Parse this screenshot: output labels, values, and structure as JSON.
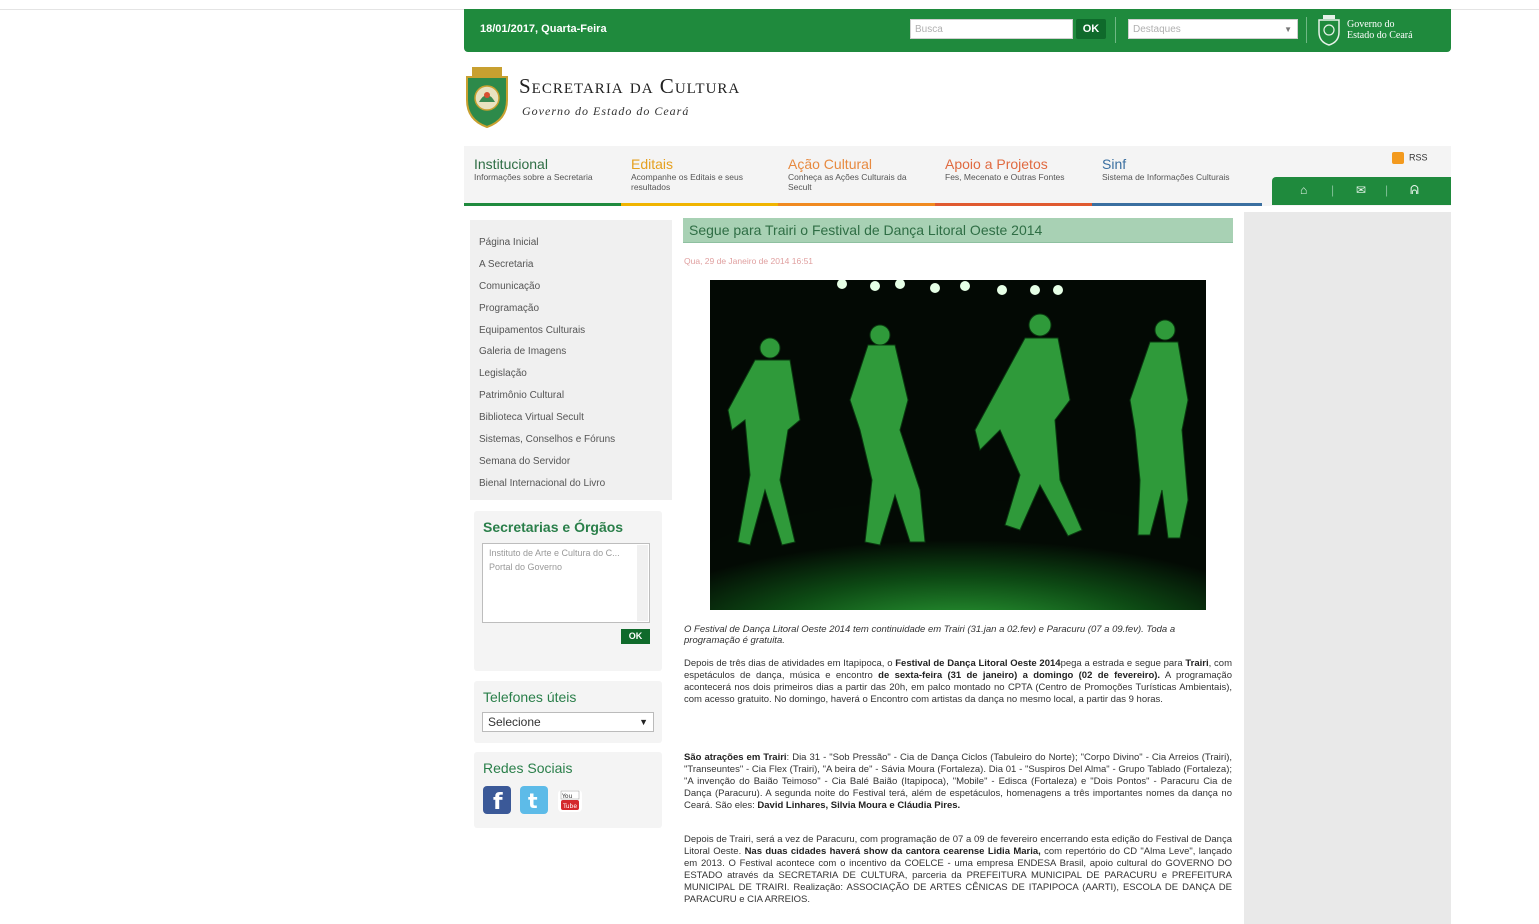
{
  "topbar": {
    "date": "18/01/2017, Quarta-Feira",
    "search_placeholder": "Busca",
    "ok": "OK",
    "destaques_placeholder": "Destaques",
    "gov_line1": "Governo do",
    "gov_line2": "Estado do Ceará"
  },
  "header": {
    "title": "Secretaria da Cultura",
    "subtitle": "Governo do Estado do Ceará"
  },
  "nav": [
    {
      "title": "Institucional",
      "desc": "Informações sobre a Secretaria",
      "color": "#2f6e45",
      "bar": "#1f8a3d"
    },
    {
      "title": "Editais",
      "desc": "Acompanhe os Editais e seus resultados",
      "color": "#e5a020",
      "bar": "#f0b400"
    },
    {
      "title": "Ação Cultural",
      "desc": "Conheça as Ações Culturais da Secult",
      "color": "#e78a40",
      "bar": "#f08a20"
    },
    {
      "title": "Apoio a Projetos",
      "desc": "Fes, Mecenato e Outras Fontes",
      "color": "#e06a40",
      "bar": "#e05a30"
    },
    {
      "title": "Sinf",
      "desc": "Sistema de Informações Culturais",
      "color": "#3a6fa0",
      "bar": "#3a6fa0"
    }
  ],
  "rss": "RSS",
  "tools": [
    "home-icon",
    "mail-icon",
    "sitemap-icon"
  ],
  "menu": [
    "Página Inicial",
    "A Secretaria",
    "Comunicação",
    "Programação",
    "Equipamentos Culturais",
    "Galeria de Imagens",
    "Legislação",
    "Patrimônio Cultural",
    "Biblioteca Virtual Secult",
    "Sistemas, Conselhos e Fóruns",
    "Semana do Servidor",
    "Bienal Internacional do Livro"
  ],
  "secretarias": {
    "title": "Secretarias e Órgãos",
    "options": [
      "Instituto de Arte e Cultura do C...",
      "Portal do Governo"
    ],
    "ok": "OK"
  },
  "telefones": {
    "title": "Telefones úteis",
    "selected": "Selecione"
  },
  "redes": {
    "title": "Redes Sociais",
    "icons": [
      "facebook-icon",
      "twitter-icon",
      "youtube-icon"
    ]
  },
  "article": {
    "title": "Segue para Trairi o Festival de Dança Litoral Oeste 2014",
    "date": "Qua, 29 de Janeiro de 2014 16:51",
    "caption": "O Festival de Dança Litoral Oeste 2014 tem continuidade em Trairi (31.jan a 02.fev) e Paracuru (07 a 09.fev). Toda a programação é gratuita.",
    "p1": [
      {
        "t": "Depois de três dias de atividades em Itapipoca, o ",
        "b": false
      },
      {
        "t": "Festival de Dança Litoral Oeste 2014",
        "b": true
      },
      {
        "t": "pega a estrada e segue para ",
        "b": false
      },
      {
        "t": "Trairi",
        "b": true
      },
      {
        "t": ", com espetáculos de dança, música e encontro ",
        "b": false
      },
      {
        "t": "de sexta-feira (31 de janeiro) a domingo (02 de fevereiro).",
        "b": true
      },
      {
        "t": " A programação acontecerá nos dois primeiros dias a partir das 20h, em palco montado no CPTA (Centro de Promoções Turísticas Ambientais), com acesso gratuito. No domingo, haverá o Encontro com artistas da dança no mesmo local, a partir das 9 horas.",
        "b": false
      }
    ],
    "p2": [
      {
        "t": "São atrações em Trairi",
        "b": true
      },
      {
        "t": ": Dia 31 - \"Sob Pressão\" - Cia de Dança Ciclos (Tabuleiro do Norte); \"Corpo Divino\" - Cia Arreios (Trairi), \"Transeuntes\" - Cia Flex (Trairi), \"A beira de\" - Sávia Moura (Fortaleza). Dia 01 - \"Suspiros Del Alma\" - Grupo Tablado (Fortaleza); \"A invenção do Baião Teimoso\" - Cia Balé Baião (Itapipoca), \"Mobile\" - Edisca (Fortaleza) e \"Dois Pontos\" - Paracuru Cia de Dança (Paracuru). A segunda noite do Festival terá, além de espetáculos, homenagens a três importantes nomes da dança no Ceará. São eles: ",
        "b": false
      },
      {
        "t": "David Linhares, Silvia Moura e Cláudia Pires.",
        "b": true
      }
    ],
    "p3": [
      {
        "t": "Depois de Trairi, será a vez de Paracuru, com programação de 07 a 09 de fevereiro encerrando esta edição do Festival de Dança Litoral Oeste. ",
        "b": false
      },
      {
        "t": "Nas duas cidades haverá show da cantora cearense Lidia Maria,",
        "b": true
      },
      {
        "t": " com repertório do CD \"Alma Leve\", lançado em 2013. O Festival acontece com o incentivo da COELCE - uma empresa ENDESA Brasil, apoio cultural do GOVERNO DO ESTADO através da SECRETARIA DE CULTURA, parceria da PREFEITURA MUNICIPAL DE PARACURU e PREFEITURA MUNICIPAL DE TRAIRI. Realização: ASSOCIAÇÃO DE ARTES CÊNICAS DE ITAPIPOCA (AARTI), ESCOLA DE DANÇA DE PARACURU e CIA ARREIOS.",
        "b": false
      }
    ]
  }
}
